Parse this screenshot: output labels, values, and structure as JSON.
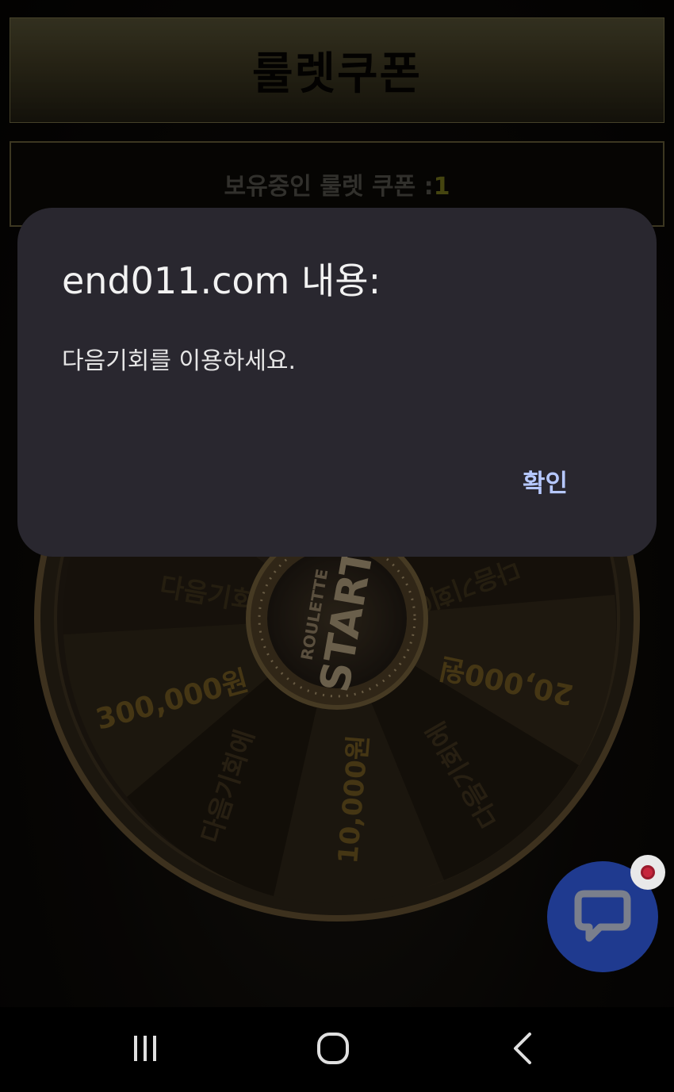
{
  "header": {
    "title": "룰렛쿠폰"
  },
  "coupon": {
    "label": "보유중인 룰렛 쿠폰 :",
    "count": "1"
  },
  "wheel": {
    "center_top": "ROULETTE",
    "center_main": "START",
    "segments": [
      "다음기회에",
      "300,000원",
      "다음기회에",
      "10,000원",
      "다음기회에",
      "20,000원",
      "다음기회에"
    ]
  },
  "dialog": {
    "title": "end011.com 내용:",
    "message": "다음기회를 이용하세요.",
    "ok_label": "확인"
  },
  "colors": {
    "dialog_bg": "#29272f",
    "ok_text": "#b6c8ff",
    "chat_button": "#1f3a8f",
    "badge_dot": "#c6263c"
  },
  "icons": {
    "chat": "chat-bubble-icon",
    "nav_recent": "recent-apps-icon",
    "nav_home": "home-icon",
    "nav_back": "back-icon"
  }
}
